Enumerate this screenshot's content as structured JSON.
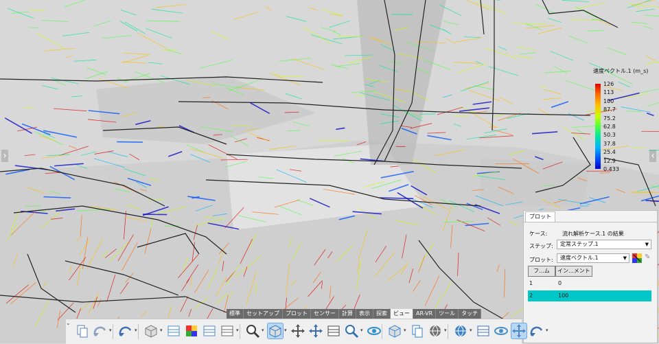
{
  "legend": {
    "title": "速度ベクトル.1 (m_s)",
    "ticks": [
      "126",
      "113",
      "100",
      "87.7",
      "75.2",
      "62.8",
      "50.3",
      "37.8",
      "25.4",
      "12.9",
      "0.433"
    ]
  },
  "plot_panel": {
    "tab": "プロット",
    "case_label": "ケース:",
    "case_value": "流れ解析ケース.1 の結果",
    "step_label": "ステップ:",
    "step_value": "定常ステップ.1",
    "plot_label": "プロット:",
    "plot_value": "速度ベクトル.1",
    "table": {
      "headers": [
        "フ...ム",
        "イン...メント"
      ],
      "rows": [
        {
          "frame": "1",
          "increment": "0",
          "selected": false
        },
        {
          "frame": "2",
          "increment": "100",
          "selected": true
        }
      ]
    }
  },
  "ribbon_tabs": [
    {
      "label": "標準",
      "active": false
    },
    {
      "label": "セットアップ",
      "active": false
    },
    {
      "label": "プロット",
      "active": false
    },
    {
      "label": "センサー",
      "active": false
    },
    {
      "label": "計算",
      "active": false
    },
    {
      "label": "表示",
      "active": false
    },
    {
      "label": "探索",
      "active": false
    },
    {
      "label": "ビュー",
      "active": true
    },
    {
      "label": "AR-VR",
      "active": false
    },
    {
      "label": "ツール",
      "active": false
    },
    {
      "label": "タッチ",
      "active": false
    }
  ],
  "toolbar_icons": [
    "copy-icon",
    "paste-icon",
    "undo-icon",
    "render-style-icon",
    "section-view-icon",
    "color-map-icon",
    "capture-image-icon",
    "table-icon",
    "zoom-icon",
    "view-cube-icon",
    "fit-all-icon",
    "pan-icon",
    "rotate-icon",
    "zoom-area-icon",
    "eye-view-icon",
    "iso-view-icon",
    "normal-view-icon",
    "shading-icon",
    "globe-icon",
    "snapshot-icon",
    "hide-show-icon",
    "select-icon",
    "refresh-icon"
  ],
  "colors": {
    "accent": "#00c8c8",
    "scale_max": "#e00000",
    "scale_min": "#0000c8"
  }
}
